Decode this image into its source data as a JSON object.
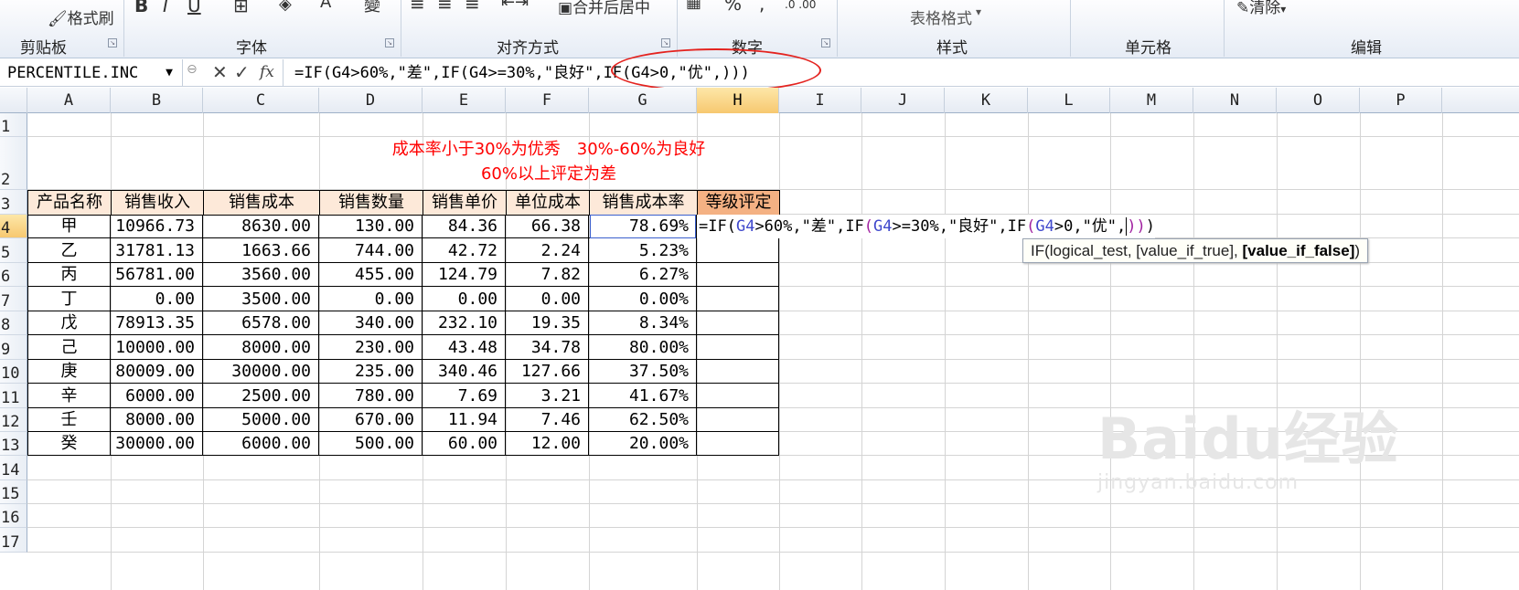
{
  "ribbon": {
    "clipboard": {
      "name": "剪贴板",
      "format_painter": "格式刷"
    },
    "font": {
      "name": "字体",
      "bold": "B",
      "italic": "I",
      "underline": "U"
    },
    "alignment": {
      "name": "对齐方式",
      "merge": "合并后居中"
    },
    "number": {
      "name": "数字",
      "percent": "%",
      "comma": ","
    },
    "styles": {
      "name": "样式",
      "table_format": "表格格式"
    },
    "cells": {
      "name": "单元格"
    },
    "editing": {
      "name": "编辑",
      "clear": "清除"
    }
  },
  "formula_bar": {
    "name_box": "PERCENTILE.INC",
    "formula": "=IF(G4>60%,\"差\",IF(G4>=30%,\"良好\",IF(G4>0,\"优\",)))",
    "cancel": "✕",
    "enter": "✓",
    "fx": "fx"
  },
  "columns": [
    "A",
    "B",
    "C",
    "D",
    "E",
    "F",
    "G",
    "H",
    "I",
    "J",
    "K",
    "L",
    "M",
    "N",
    "O",
    "P"
  ],
  "rows": [
    "1",
    "2",
    "3",
    "4",
    "5",
    "6",
    "7",
    "8",
    "9",
    "10",
    "11",
    "12",
    "13",
    "14",
    "15",
    "16",
    "17"
  ],
  "note": {
    "line1": "成本率小于30%为优秀　30%-60%为良好",
    "line2": "60%以上评定为差"
  },
  "table": {
    "headers": [
      "产品名称",
      "销售收入",
      "销售成本",
      "销售数量",
      "销售单价",
      "单位成本",
      "销售成本率",
      "等级评定"
    ],
    "data": [
      [
        "甲",
        "10966.73",
        "8630.00",
        "130.00",
        "84.36",
        "66.38",
        "78.69%",
        ""
      ],
      [
        "乙",
        "31781.13",
        "1663.66",
        "744.00",
        "42.72",
        "2.24",
        "5.23%",
        ""
      ],
      [
        "丙",
        "56781.00",
        "3560.00",
        "455.00",
        "124.79",
        "7.82",
        "6.27%",
        ""
      ],
      [
        "丁",
        "0.00",
        "3500.00",
        "0.00",
        "0.00",
        "0.00",
        "0.00%",
        ""
      ],
      [
        "戊",
        "78913.35",
        "6578.00",
        "340.00",
        "232.10",
        "19.35",
        "8.34%",
        ""
      ],
      [
        "己",
        "10000.00",
        "8000.00",
        "230.00",
        "43.48",
        "34.78",
        "80.00%",
        ""
      ],
      [
        "庚",
        "80009.00",
        "30000.00",
        "235.00",
        "340.46",
        "127.66",
        "37.50%",
        ""
      ],
      [
        "辛",
        "6000.00",
        "2500.00",
        "780.00",
        "7.69",
        "3.21",
        "41.67%",
        ""
      ],
      [
        "壬",
        "8000.00",
        "5000.00",
        "670.00",
        "11.94",
        "7.46",
        "62.50%",
        ""
      ],
      [
        "癸",
        "30000.00",
        "6000.00",
        "500.00",
        "60.00",
        "12.00",
        "20.00%",
        ""
      ]
    ]
  },
  "edit_cell": {
    "p1": "=IF(",
    "r1": "G4",
    "p2": ">60%,\"差\",IF",
    "o2": "(",
    "r2": "G4",
    "p3": ">=30%,\"良好\",IF",
    "o3": "(",
    "r3": "G4",
    "p4": ">0,\"优\",",
    "c3": ")",
    "c2": ")",
    "c1": ")"
  },
  "tooltip": {
    "prefix": "IF(logical_test, [value_if_true], ",
    "bold": "[value_if_false]",
    "suffix": ")"
  },
  "watermark": {
    "line1": "Baidu经验",
    "line2": "jingyan.baidu.com"
  }
}
